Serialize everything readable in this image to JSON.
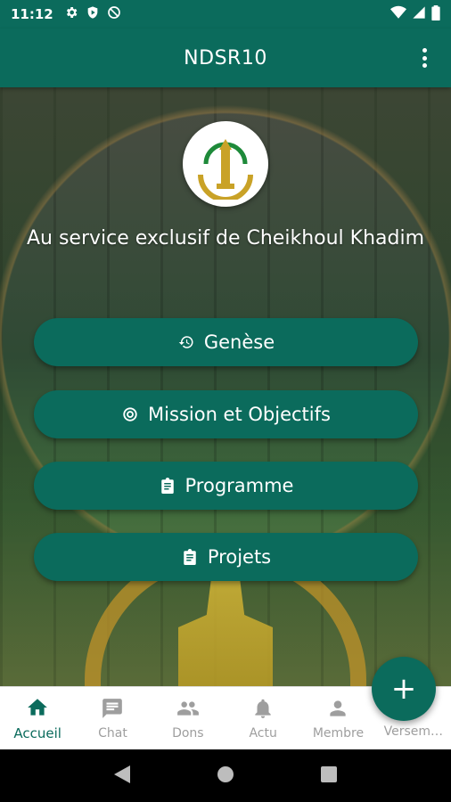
{
  "status_bar": {
    "time": "11:12"
  },
  "app_bar": {
    "title": "NDSR10"
  },
  "main": {
    "tagline": "Au service exclusif de Cheikhoul Khadim",
    "buttons": [
      {
        "label": "Genèse",
        "icon": "history-icon"
      },
      {
        "label": "Mission et Objectifs",
        "icon": "target-icon"
      },
      {
        "label": "Programme",
        "icon": "clipboard-icon"
      },
      {
        "label": "Projets",
        "icon": "clipboard-icon"
      }
    ]
  },
  "fab": {
    "label": "+"
  },
  "bottom_nav": {
    "items": [
      {
        "label": "Accueil",
        "icon": "home-icon",
        "active": true
      },
      {
        "label": "Chat",
        "icon": "chat-icon"
      },
      {
        "label": "Dons",
        "icon": "people-icon"
      },
      {
        "label": "Actu",
        "icon": "bell-icon"
      },
      {
        "label": "Membre",
        "icon": "person-icon"
      },
      {
        "label": "Versem…",
        "icon": "payment-icon"
      }
    ]
  },
  "colors": {
    "primary": "#0b6b5c",
    "inactive": "#9e9e9e"
  }
}
